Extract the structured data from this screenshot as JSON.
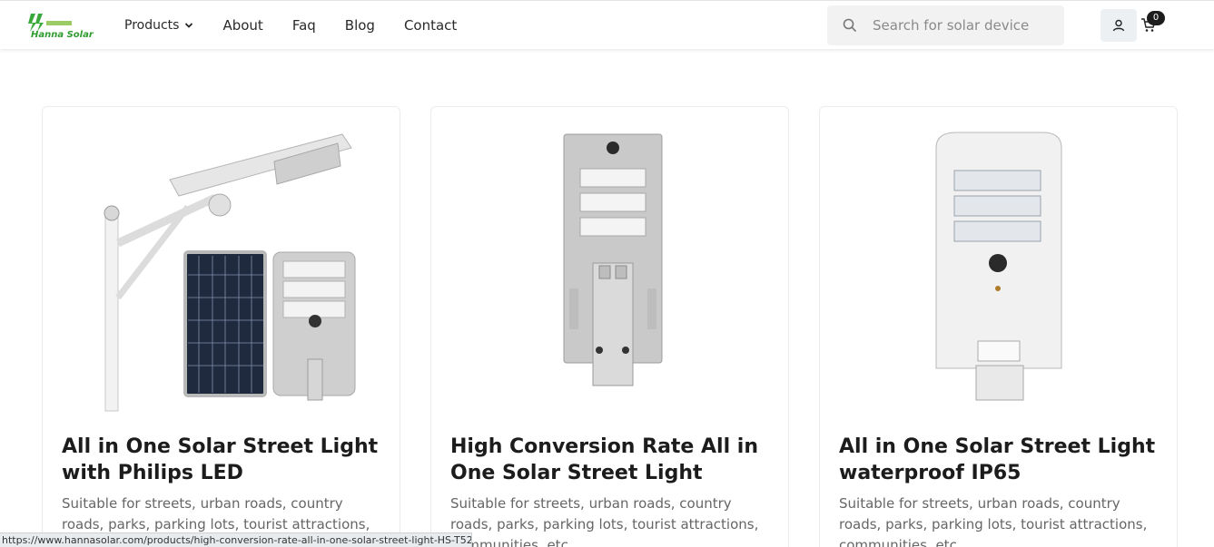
{
  "header": {
    "logo": {
      "text": "Hanna Solar",
      "color": "#2e9c2e"
    },
    "nav": [
      {
        "label": "Products",
        "has_dropdown": true
      },
      {
        "label": "About"
      },
      {
        "label": "Faq"
      },
      {
        "label": "Blog"
      },
      {
        "label": "Contact"
      }
    ],
    "search": {
      "placeholder": "Search for solar device",
      "value": ""
    },
    "account_icon": "user-icon",
    "cart": {
      "icon": "cart-icon",
      "count": "0"
    }
  },
  "products": [
    {
      "title": "All in One Solar Street Light with Philips LED",
      "description": "Suitable for streets, urban roads, country roads, parks, parking lots, tourist attractions, communities, etc"
    },
    {
      "title": "High Conversion Rate All in One Solar Street Light",
      "description": "Suitable for streets, urban roads, country roads, parks, parking lots, tourist attractions, communities, etc"
    },
    {
      "title": "All in One Solar Street Light waterproof IP65",
      "description": "Suitable for streets, urban roads, country roads, parks, parking lots, tourist attractions, communities, etc"
    }
  ],
  "status_bar": {
    "url": "https://www.hannasolar.com/products/high-conversion-rate-all-in-one-solar-street-light-HS-T52"
  }
}
